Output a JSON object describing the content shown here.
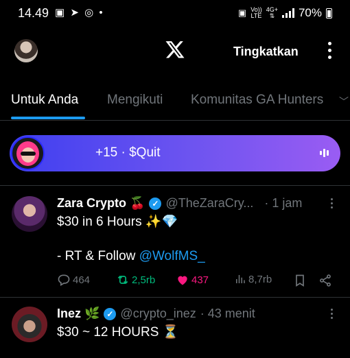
{
  "status_bar": {
    "time": "14.49",
    "notification_icons": [
      "image-icon",
      "telegram-icon",
      "whatsapp-icon",
      "dot-icon"
    ],
    "network_top": "Vo))",
    "network_lte": "LTE",
    "network_4g": "4G+",
    "battery": "70%"
  },
  "header": {
    "logo": "x-logo",
    "upgrade_label": "Tingkatkan"
  },
  "tabs": [
    {
      "label": "Untuk Anda",
      "active": true
    },
    {
      "label": "Mengikuti",
      "active": false
    },
    {
      "label": "Komunitas GA Hunters",
      "active": false
    }
  ],
  "spaces_banner": {
    "text": "+15 · $Quit"
  },
  "tweets": [
    {
      "name": "Zara Crypto 🍒",
      "handle": "@TheZaraCry...",
      "time": "· 1 jam",
      "line1": "$30 in 6 Hours ✨💎",
      "line2_prefix": "- RT & Follow ",
      "line2_link": "@WolfMS_",
      "replies": "464",
      "reposts": "2,5rb",
      "likes": "437",
      "views": "8,7rb"
    },
    {
      "name": "Inez 🌿",
      "handle": "@crypto_inez",
      "time": "· 43 menit",
      "line1": "$30 ~ 12 HOURS ⏳"
    }
  ],
  "colors": {
    "accent": "#1d9bf0",
    "repost": "#00ba7c",
    "like": "#f91880",
    "background": "#000000"
  }
}
